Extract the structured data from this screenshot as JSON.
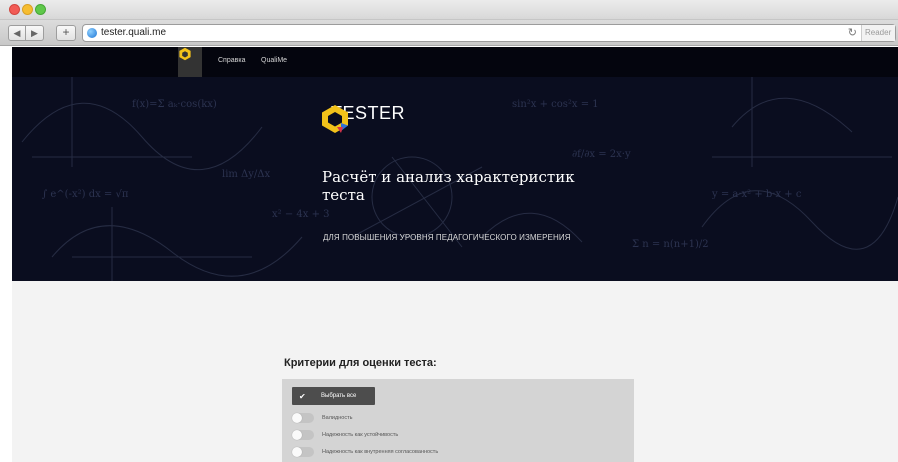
{
  "browser": {
    "url": "tester.quali.me",
    "reader_label": "Reader"
  },
  "nav": {
    "items": [
      "Справка",
      "QualiMe"
    ]
  },
  "hero": {
    "brand": "TESTER",
    "title": "Расчёт и анализ характеристик теста",
    "subtitle": "ДЛЯ ПОВЫШЕНИЯ УРОВНЯ ПЕДАГОГИЧЕСКОГО ИЗМЕРЕНИЯ"
  },
  "criteria": {
    "heading": "Критерии для оценки теста:",
    "select_all": "Выбрать все",
    "items": [
      "Валидность",
      "Надежность как устойчивость",
      "Надежность как внутренняя согласованность"
    ]
  },
  "colors": {
    "hero_bg": "#0a0d1f",
    "logo_yellow": "#f2c21a",
    "logo_blue": "#2f6fd6",
    "button_dark": "#4d4d4d"
  }
}
